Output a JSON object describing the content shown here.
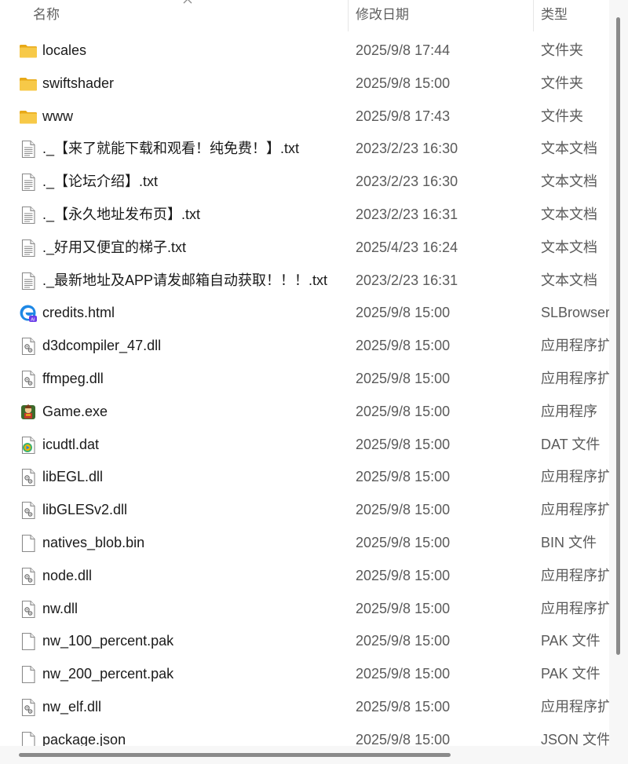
{
  "header": {
    "name_label": "名称",
    "date_label": "修改日期",
    "type_label": "类型",
    "sort": "ascending"
  },
  "files": [
    {
      "name": "locales",
      "date": "2025/9/8 17:44",
      "type": "文件夹",
      "icon": "folder-icon"
    },
    {
      "name": "swiftshader",
      "date": "2025/9/8 15:00",
      "type": "文件夹",
      "icon": "folder-icon"
    },
    {
      "name": "www",
      "date": "2025/9/8 17:43",
      "type": "文件夹",
      "icon": "folder-icon"
    },
    {
      "name": "._【来了就能下载和观看！纯免费！】.txt",
      "date": "2023/2/23 16:30",
      "type": "文本文档",
      "icon": "text-file-icon"
    },
    {
      "name": "._【论坛介绍】.txt",
      "date": "2023/2/23 16:30",
      "type": "文本文档",
      "icon": "text-file-icon"
    },
    {
      "name": "._【永久地址发布页】.txt",
      "date": "2023/2/23 16:31",
      "type": "文本文档",
      "icon": "text-file-icon"
    },
    {
      "name": "._好用又便宜的梯子.txt",
      "date": "2025/4/23 16:24",
      "type": "文本文档",
      "icon": "text-file-icon"
    },
    {
      "name": "._最新地址及APP请发邮箱自动获取！！！.txt",
      "date": "2023/2/23 16:31",
      "type": "文本文档",
      "icon": "text-file-icon"
    },
    {
      "name": "credits.html",
      "date": "2025/9/8 15:00",
      "type": "SLBrowser",
      "icon": "browser-html-icon"
    },
    {
      "name": "d3dcompiler_47.dll",
      "date": "2025/9/8 15:00",
      "type": "应用程序扩",
      "icon": "dll-file-icon"
    },
    {
      "name": "ffmpeg.dll",
      "date": "2025/9/8 15:00",
      "type": "应用程序扩",
      "icon": "dll-file-icon"
    },
    {
      "name": "Game.exe",
      "date": "2025/9/8 15:00",
      "type": "应用程序",
      "icon": "game-exe-icon"
    },
    {
      "name": "icudtl.dat",
      "date": "2025/9/8 15:00",
      "type": "DAT 文件",
      "icon": "media-file-icon"
    },
    {
      "name": "libEGL.dll",
      "date": "2025/9/8 15:00",
      "type": "应用程序扩",
      "icon": "dll-file-icon"
    },
    {
      "name": "libGLESv2.dll",
      "date": "2025/9/8 15:00",
      "type": "应用程序扩",
      "icon": "dll-file-icon"
    },
    {
      "name": "natives_blob.bin",
      "date": "2025/9/8 15:00",
      "type": "BIN 文件",
      "icon": "blank-file-icon"
    },
    {
      "name": "node.dll",
      "date": "2025/9/8 15:00",
      "type": "应用程序扩",
      "icon": "dll-file-icon"
    },
    {
      "name": "nw.dll",
      "date": "2025/9/8 15:00",
      "type": "应用程序扩",
      "icon": "dll-file-icon"
    },
    {
      "name": "nw_100_percent.pak",
      "date": "2025/9/8 15:00",
      "type": "PAK 文件",
      "icon": "blank-file-icon"
    },
    {
      "name": "nw_200_percent.pak",
      "date": "2025/9/8 15:00",
      "type": "PAK 文件",
      "icon": "blank-file-icon"
    },
    {
      "name": "nw_elf.dll",
      "date": "2025/9/8 15:00",
      "type": "应用程序扩",
      "icon": "dll-file-icon"
    },
    {
      "name": "package.json",
      "date": "2025/9/8 15:00",
      "type": "JSON 文件",
      "icon": "blank-file-icon"
    }
  ],
  "colors": {
    "folder": "#f7c948",
    "folder_dark": "#e8a917",
    "accent_blue": "#1e88e5",
    "row_hover": "#e5f3ff"
  }
}
